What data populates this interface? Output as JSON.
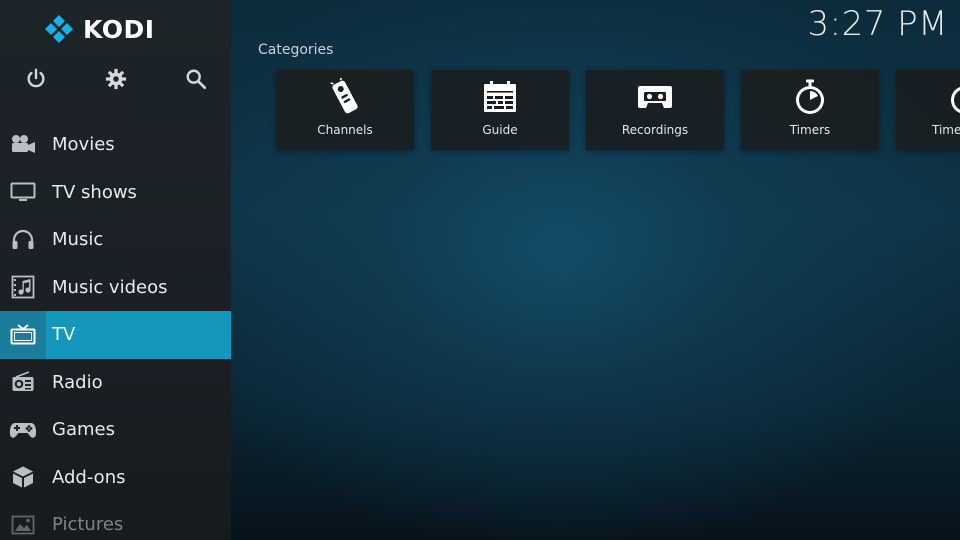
{
  "app": {
    "name": "KODI"
  },
  "clock": {
    "time": "3:27 PM"
  },
  "colors": {
    "accent": "#1397bd",
    "logo_blue": "#17b2e7",
    "sidebar_bg": "#1d2429"
  },
  "top_icons": [
    {
      "icon": "power-icon"
    },
    {
      "icon": "gear-icon"
    },
    {
      "icon": "search-icon"
    }
  ],
  "sidebar": {
    "items": [
      {
        "label": "Movies",
        "icon": "movie-camera-icon"
      },
      {
        "label": "TV shows",
        "icon": "tv-monitor-icon"
      },
      {
        "label": "Music",
        "icon": "headphones-icon"
      },
      {
        "label": "Music videos",
        "icon": "music-video-icon"
      },
      {
        "label": "TV",
        "icon": "tv-antenna-icon",
        "active": true
      },
      {
        "label": "Radio",
        "icon": "radio-icon"
      },
      {
        "label": "Games",
        "icon": "gamepad-icon"
      },
      {
        "label": "Add-ons",
        "icon": "addons-box-icon"
      },
      {
        "label": "Pictures",
        "icon": "pictures-icon"
      }
    ]
  },
  "main": {
    "section_title": "Categories",
    "tiles": [
      {
        "label": "Channels",
        "icon": "remote-control-icon"
      },
      {
        "label": "Guide",
        "icon": "guide-grid-icon"
      },
      {
        "label": "Recordings",
        "icon": "cassette-icon"
      },
      {
        "label": "Timers",
        "icon": "stopwatch-icon"
      },
      {
        "label": "Timers",
        "icon": "stopwatch-icon"
      }
    ]
  }
}
